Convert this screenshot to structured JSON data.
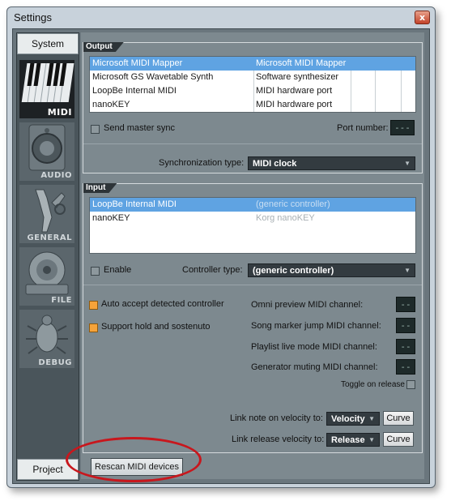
{
  "window": {
    "title": "Settings",
    "close_glyph": "x"
  },
  "sidebar": {
    "top_tab": "System",
    "bottom_tab": "Project",
    "categories": [
      {
        "label": "MIDI",
        "icon": "midi-keyboard-icon",
        "active": true
      },
      {
        "label": "AUDIO",
        "icon": "speaker-icon",
        "active": false
      },
      {
        "label": "GENERAL",
        "icon": "wrench-icon",
        "active": false
      },
      {
        "label": "FILE",
        "icon": "disc-icon",
        "active": false
      },
      {
        "label": "DEBUG",
        "icon": "bug-icon",
        "active": false
      }
    ]
  },
  "output": {
    "header": "Output",
    "rows": [
      {
        "name": "Microsoft MIDI Mapper",
        "type": "Microsoft MIDI Mapper",
        "selected": true
      },
      {
        "name": "Microsoft GS Wavetable Synth",
        "type": "Software synthesizer",
        "selected": false
      },
      {
        "name": "LoopBe Internal MIDI",
        "type": "MIDI hardware port",
        "selected": false
      },
      {
        "name": "nanoKEY",
        "type": "MIDI hardware port",
        "selected": false
      }
    ],
    "send_master_sync": "Send master sync",
    "port_number_label": "Port number:",
    "port_number_value": "---",
    "sync_type_label": "Synchronization type:",
    "sync_type_value": "MIDI clock"
  },
  "input": {
    "header": "Input",
    "rows": [
      {
        "name": "LoopBe Internal MIDI",
        "type": "(generic controller)",
        "selected": true
      },
      {
        "name": "nanoKEY",
        "type": "Korg nanoKEY",
        "selected": false
      }
    ],
    "enable_label": "Enable",
    "controller_type_label": "Controller type:",
    "controller_type_value": "(generic controller)",
    "auto_accept": "Auto accept detected controller",
    "support_hold": "Support hold and sostenuto",
    "omni_label": "Omni preview MIDI channel:",
    "song_marker_label": "Song marker jump MIDI channel:",
    "playlist_label": "Playlist live mode MIDI channel:",
    "generator_label": "Generator muting MIDI channel:",
    "channel_value": "--",
    "toggle_on_release": "Toggle on release",
    "link_note_label": "Link note on velocity to:",
    "link_note_value": "Velocity",
    "link_release_label": "Link release velocity to:",
    "link_release_value": "Release",
    "curve_label": "Curve"
  },
  "rescan_button": "Rescan MIDI devices",
  "colors": {
    "highlight_ellipse": "#c8171d",
    "selection": "#5fa3e2",
    "orange_check": "#f6a33a"
  }
}
